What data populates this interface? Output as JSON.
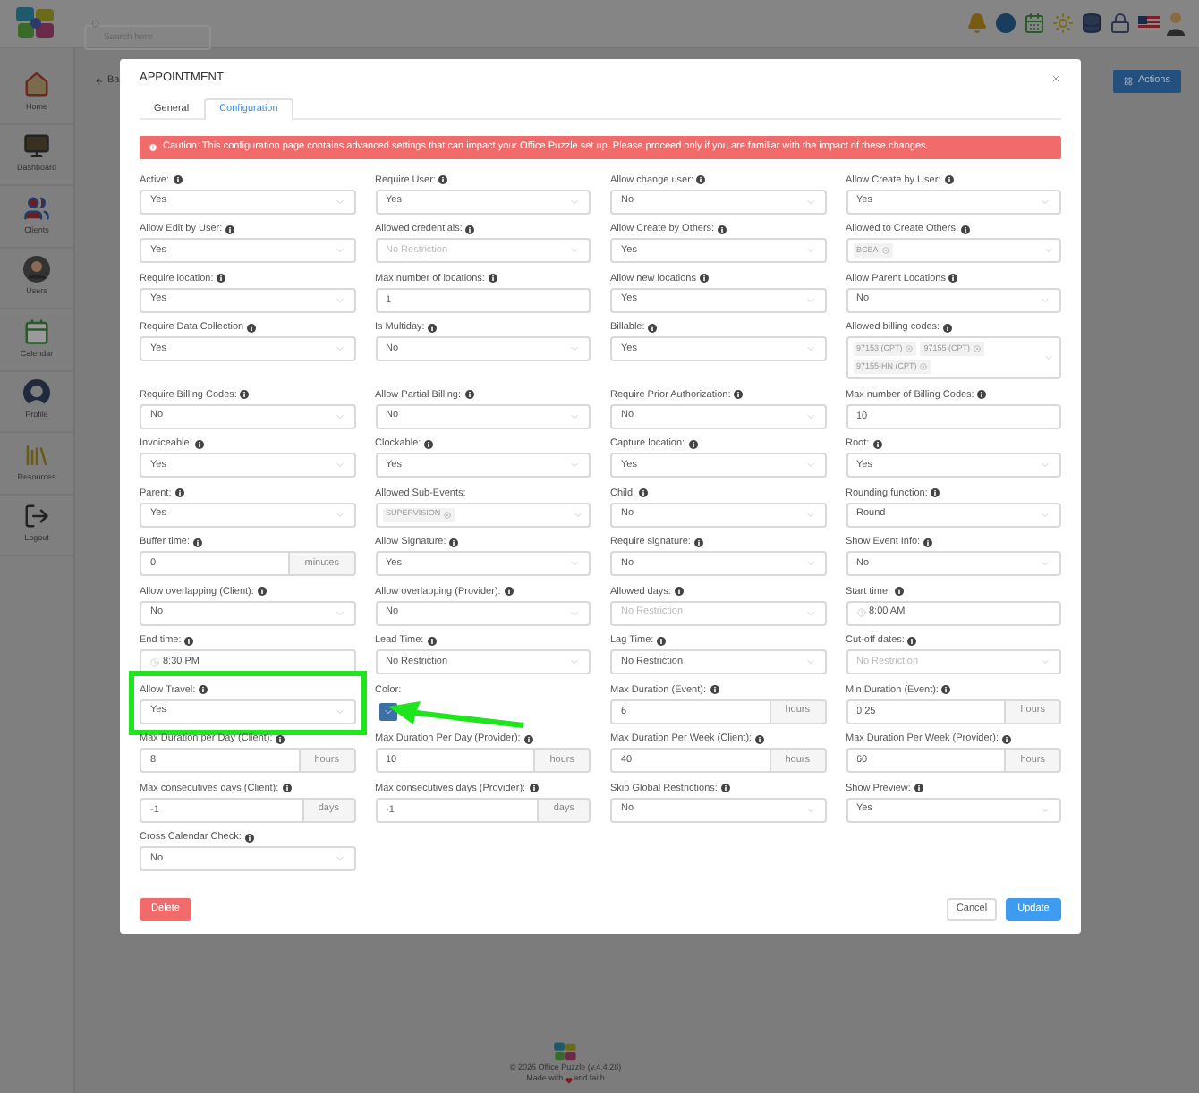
{
  "header": {
    "search": {
      "placeholder": "Search here"
    }
  },
  "sidebar": {
    "items": [
      {
        "label": "Home"
      },
      {
        "label": "Dashboard"
      },
      {
        "label": "Clients"
      },
      {
        "label": "Users"
      },
      {
        "label": "Calendar"
      },
      {
        "label": "Profile"
      },
      {
        "label": "Resources"
      },
      {
        "label": "Logout"
      }
    ]
  },
  "page": {
    "back_link": "Ba",
    "actions_button": "Actions"
  },
  "modal": {
    "title": "APPOINTMENT",
    "tabs": [
      {
        "label": "General",
        "selected": false
      },
      {
        "label": "Configuration",
        "selected": true
      }
    ],
    "alert": "Caution: This configuration page contains advanced settings that can impact your Office Puzzle set up. Please proceed only if you are familiar with the impact of these changes.",
    "fields": [
      {
        "label": "Active:",
        "info": true,
        "kind": "select",
        "value": "Yes"
      },
      {
        "label": "Require User:",
        "info": true,
        "kind": "select",
        "value": "Yes"
      },
      {
        "label": "Allow change user:",
        "info": true,
        "kind": "select",
        "value": "No"
      },
      {
        "label": "Allow Create by User:",
        "info": true,
        "kind": "select",
        "value": "Yes"
      },
      {
        "label": "Allow Edit by User:",
        "info": true,
        "kind": "select",
        "value": "Yes"
      },
      {
        "label": "Allowed credentials:",
        "info": true,
        "kind": "select",
        "placeholder": "No Restriction"
      },
      {
        "label": "Allow Create by Others:",
        "info": true,
        "kind": "select",
        "value": "Yes"
      },
      {
        "label": "Allowed to Create Others:",
        "info": true,
        "kind": "tags",
        "tags": [
          "BCBA"
        ]
      },
      {
        "label": "Require location:",
        "info": true,
        "kind": "select",
        "value": "Yes"
      },
      {
        "label": "Max number of locations:",
        "info": true,
        "kind": "input",
        "value": "1"
      },
      {
        "label": "Allow new locations",
        "info": true,
        "kind": "select",
        "value": "Yes"
      },
      {
        "label": "Allow Parent Locations",
        "info": true,
        "kind": "select",
        "value": "No"
      },
      {
        "label": "Require Data Collection",
        "info": true,
        "kind": "select",
        "value": "Yes"
      },
      {
        "label": "Is Multiday:",
        "info": true,
        "kind": "select",
        "value": "No"
      },
      {
        "label": "Billable:",
        "info": true,
        "kind": "select",
        "value": "Yes"
      },
      {
        "label": "Allowed billing codes:",
        "info": true,
        "kind": "tags",
        "tags": [
          "97153 (CPT)",
          "97155 (CPT)",
          "97155-HN (CPT)"
        ]
      },
      {
        "label": "Require Billing Codes:",
        "info": true,
        "kind": "select",
        "value": "No"
      },
      {
        "label": "Allow Partial Billing:",
        "info": true,
        "kind": "select",
        "value": "No"
      },
      {
        "label": "Require Prior Authorization:",
        "info": true,
        "kind": "select",
        "value": "No"
      },
      {
        "label": "Max number of Billing Codes:",
        "info": true,
        "kind": "input",
        "value": "10"
      },
      {
        "label": "Invoiceable:",
        "info": true,
        "kind": "select",
        "value": "Yes"
      },
      {
        "label": "Clockable:",
        "info": true,
        "kind": "select",
        "value": "Yes"
      },
      {
        "label": "Capture location:",
        "info": true,
        "kind": "select",
        "value": "Yes"
      },
      {
        "label": "Root:",
        "info": true,
        "kind": "select",
        "value": "Yes"
      },
      {
        "label": "Parent:",
        "info": true,
        "kind": "select",
        "value": "Yes"
      },
      {
        "label": "Allowed Sub-Events:",
        "info": false,
        "kind": "tags",
        "tags": [
          "SUPERVISION"
        ]
      },
      {
        "label": "Child:",
        "info": true,
        "kind": "select",
        "value": "No"
      },
      {
        "label": "Rounding function:",
        "info": true,
        "kind": "select",
        "value": "Round"
      },
      {
        "label": "Buffer time:",
        "info": true,
        "kind": "addon",
        "value": "0",
        "unit": "minutes"
      },
      {
        "label": "Allow Signature:",
        "info": true,
        "kind": "select",
        "value": "Yes"
      },
      {
        "label": "Require signature:",
        "info": true,
        "kind": "select",
        "value": "No"
      },
      {
        "label": "Show Event Info:",
        "info": true,
        "kind": "select",
        "value": "No"
      },
      {
        "label": "Allow overlapping (Client):",
        "info": true,
        "kind": "select",
        "value": "No"
      },
      {
        "label": "Allow overlapping (Provider):",
        "info": true,
        "kind": "select",
        "value": "No"
      },
      {
        "label": "Allowed days:",
        "info": true,
        "kind": "select",
        "placeholder": "No Restriction"
      },
      {
        "label": "Start time:",
        "info": true,
        "kind": "time",
        "value": "8:00 AM"
      },
      {
        "label": "End time:",
        "info": true,
        "kind": "time",
        "value": "8:30 PM"
      },
      {
        "label": "Lead Time:",
        "info": true,
        "kind": "select",
        "value": "No Restriction"
      },
      {
        "label": "Lag Time:",
        "info": true,
        "kind": "select",
        "value": "No Restriction"
      },
      {
        "label": "Cut-off dates:",
        "info": true,
        "kind": "select",
        "placeholder": "No Restriction"
      },
      {
        "label": "Allow Travel:",
        "info": true,
        "kind": "select",
        "value": "Yes",
        "highlighted": true
      },
      {
        "label": "Color:",
        "info": false,
        "kind": "color",
        "color": "#3d6fa8"
      },
      {
        "label": "Max Duration (Event):",
        "info": true,
        "kind": "addon",
        "value": "6",
        "unit": "hours"
      },
      {
        "label": "Min Duration (Event):",
        "info": true,
        "kind": "addon",
        "value": "0.25",
        "unit": "hours"
      },
      {
        "label": "Max Duration per Day (Client):",
        "info": true,
        "kind": "addon",
        "value": "8",
        "unit": "hours"
      },
      {
        "label": "Max Duration Per Day (Provider):",
        "info": true,
        "kind": "addon",
        "value": "10",
        "unit": "hours"
      },
      {
        "label": "Max Duration Per Week (Client):",
        "info": true,
        "kind": "addon",
        "value": "40",
        "unit": "hours"
      },
      {
        "label": "Max Duration Per Week (Provider):",
        "info": true,
        "kind": "addon",
        "value": "60",
        "unit": "hours"
      },
      {
        "label": "Max consecutives days (Client):",
        "info": true,
        "kind": "addon",
        "value": "-1",
        "unit": "days"
      },
      {
        "label": "Max consecutives days (Provider):",
        "info": true,
        "kind": "addon",
        "value": "-1",
        "unit": "days"
      },
      {
        "label": "Skip Global Restrictions:",
        "info": true,
        "kind": "select",
        "value": "No"
      },
      {
        "label": "Show Preview:",
        "info": true,
        "kind": "select",
        "value": "Yes"
      },
      {
        "label": "Cross Calendar Check:",
        "info": true,
        "kind": "select",
        "value": "No"
      }
    ],
    "buttons": {
      "delete": "Delete",
      "cancel": "Cancel",
      "update": "Update"
    }
  },
  "footer": {
    "copyright": "© 2026 Office Puzzle (v.4.4.28)",
    "made_with": "Made with",
    "faith": "and faith"
  }
}
